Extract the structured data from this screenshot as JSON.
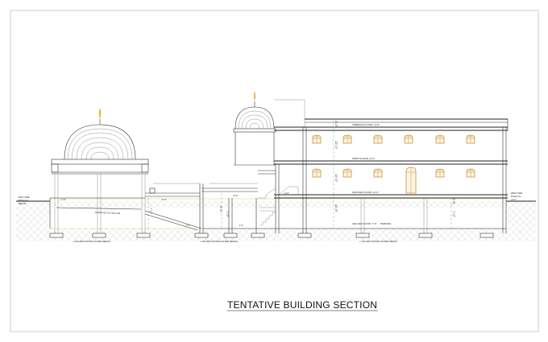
{
  "title": "TENTATIVE BUILDING SECTION",
  "levels": {
    "terrace": "TERRACE FLOOR  +4'-0\"",
    "first": "FIRST FLOOR  +4'-0\"",
    "ground": "GROUND FLOOR  +0'-0\"",
    "cellar": "CELLAR FLOOR  -7'-0\"",
    "parking": "PARKING"
  },
  "road_labels": {
    "east": [
      "EAST SIDE",
      "ROAD LVL",
      "BELOW"
    ],
    "west": [
      "WEST SIDE",
      "ROAD LVL",
      "+0'-0\""
    ]
  },
  "ramp": "RAMP DN TO CELLAR",
  "footing_notes": {
    "left": "+ COLUMN FOOTING AS PER DESIGN",
    "middle": "+ COLUMN FOOTING AS PER DESIGN",
    "right": "+ COLUMN FOOTING AS PER DESIGN"
  },
  "dimensions": {
    "terrace_height": "4'-0\"",
    "first_height": "12'-0\"",
    "ground_height": "12'-0\"",
    "cellar_height": "11'-6\"",
    "left_drop": "7'-0\"",
    "mid_drop_a": "5'-0\"",
    "mid_drop_b": "7'-0\"",
    "right_drop_a": "4'-6\"",
    "right_drop_b": "7'-0\"",
    "left_level": "+1'-0\"",
    "left_step": "+0'-6\"",
    "mid_level": "+0'-0\"",
    "stair_level": "+4'-6\"",
    "cellar_left": "-7'-0\"",
    "cellar_mid": "-7'-0\"",
    "cellar_right": "-7'-0\""
  }
}
